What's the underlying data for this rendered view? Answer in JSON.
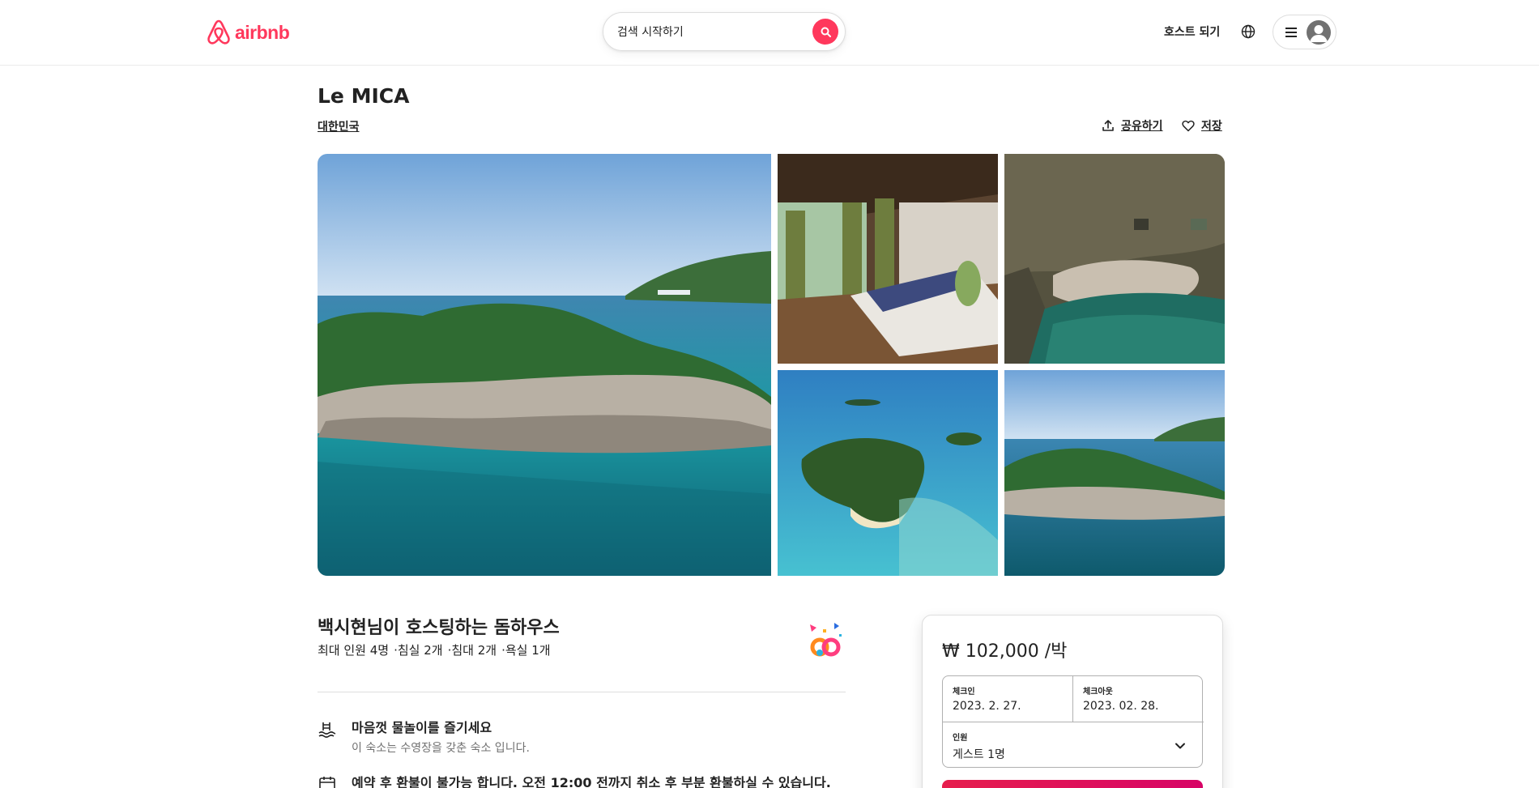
{
  "header": {
    "logo_text": "airbnb",
    "search_placeholder": "검색 시작하기",
    "host_link": "호스트 되기",
    "icons": [
      "airbnb-logo-icon",
      "search-icon",
      "globe-icon",
      "menu-icon",
      "user-avatar-icon"
    ]
  },
  "listing": {
    "title": "Le MICA",
    "location": "대한민국",
    "share_label": "공유하기",
    "save_label": "저장"
  },
  "host": {
    "title": "백시현님이 호스팅하는 돔하우스",
    "details": [
      "최대 인원 4명",
      "·침실 2개",
      "·침대 2개",
      "·욕실 1개"
    ]
  },
  "features": [
    {
      "title": "마음껏 물놀이를 즐기세요",
      "desc": "이 숙소는 수영장을 갖춘 숙소 입니다.",
      "icon": "pool-icon"
    },
    {
      "title": "예약 후 환불이 불가능 합니다. 오전 12:00 전까지 취소 후 부분 환불하실 수 있습니다.",
      "icon": "calendar-icon"
    }
  ],
  "booking": {
    "price": "₩ 102,000",
    "price_unit": "/박",
    "checkin_label": "체크인",
    "checkin_value": "2023. 2. 27.",
    "checkout_label": "체크아웃",
    "checkout_value": "2023. 02. 28.",
    "guests_label": "인원",
    "guests_value": "게스트 1명"
  },
  "colors": {
    "brand": "#ff385c",
    "reserve_button": "#e61e4d"
  }
}
